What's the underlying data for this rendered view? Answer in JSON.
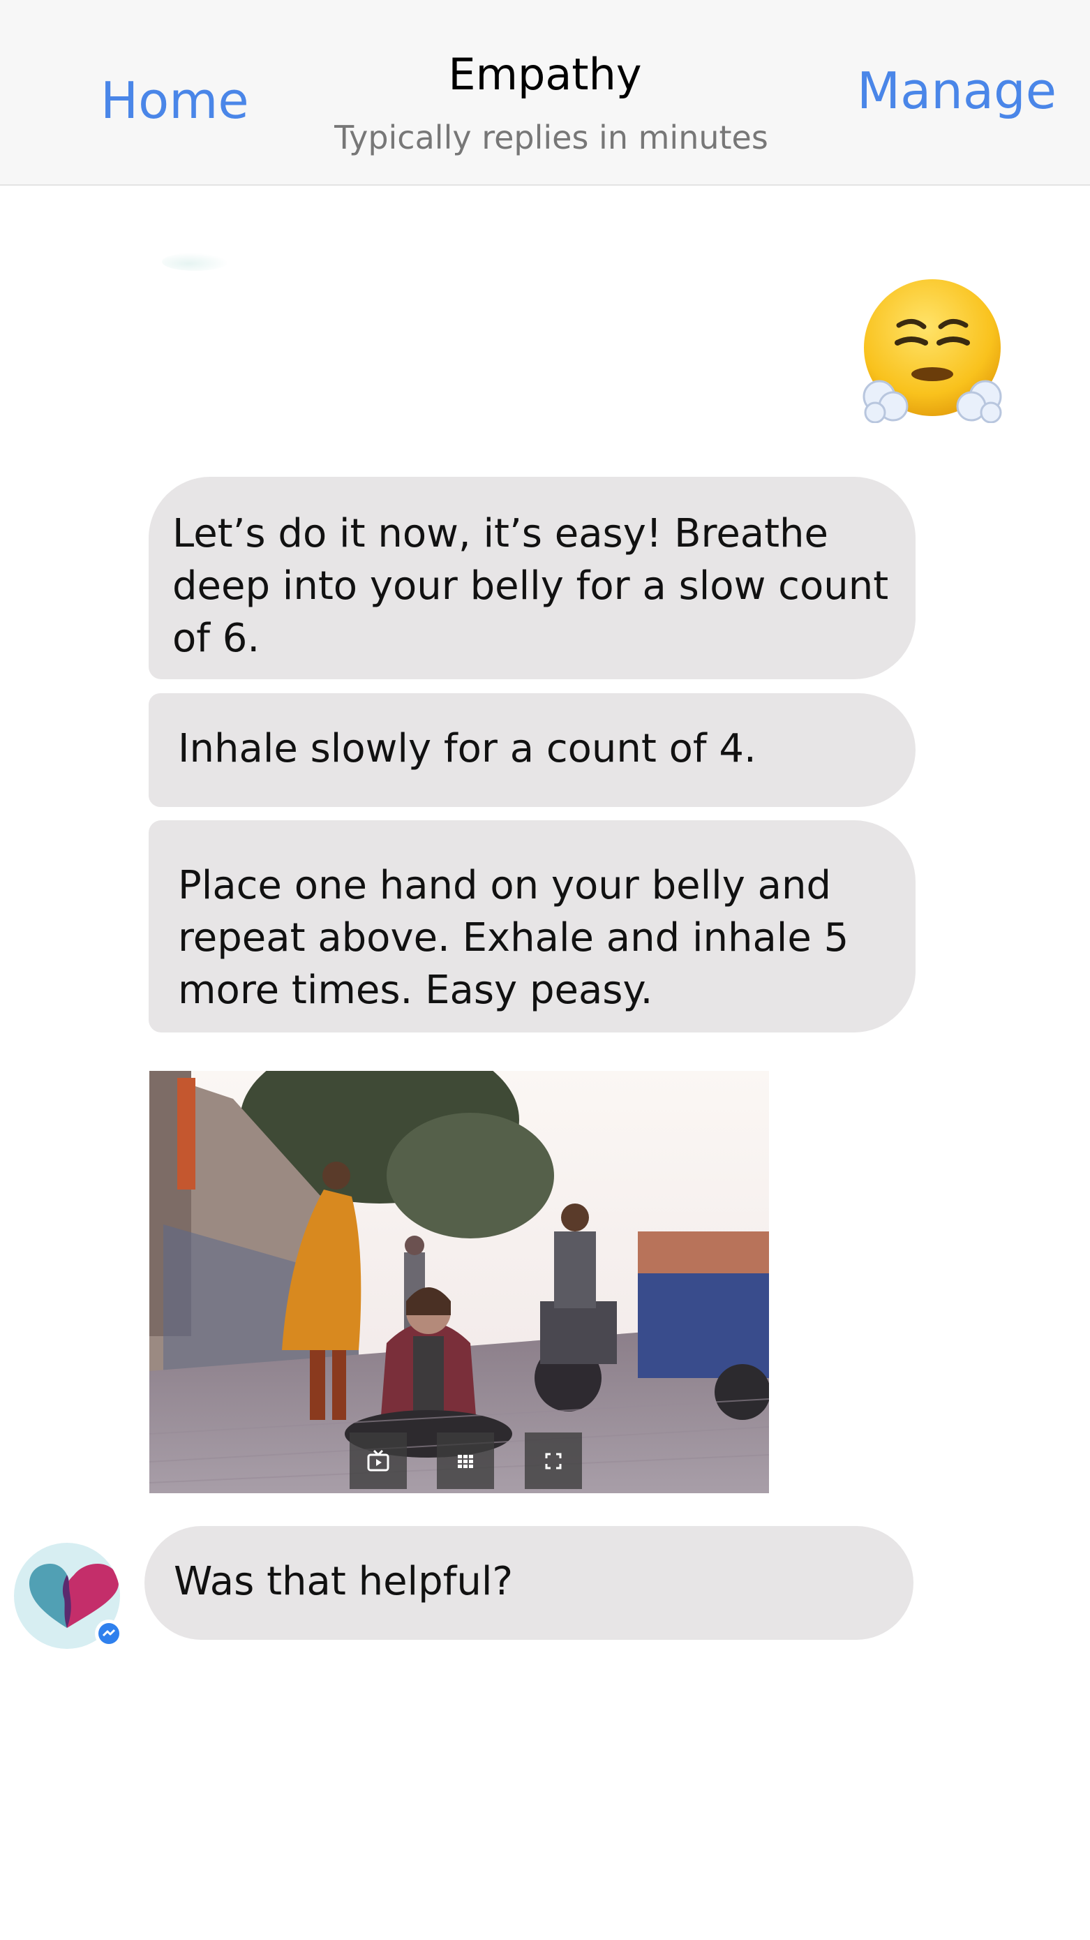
{
  "header": {
    "home_label": "Home",
    "title": "Empathy",
    "subtitle": "Typically replies in minutes",
    "manage_label": "Manage"
  },
  "messages": [
    {
      "text": "Let’s do it now, it’s easy! Breathe deep into your belly for a slow count of 6."
    },
    {
      "text": "Inhale slowly for a count of 4."
    },
    {
      "text": "Place one hand on your belly and repeat above. Exhale and inhale 5 more times. Easy peasy."
    },
    {
      "text": "Was that helpful?"
    }
  ],
  "media_controls": [
    "tv-icon",
    "grid-icon",
    "fullscreen-icon"
  ],
  "emoji": "steam-from-nose-emoji",
  "colors": {
    "accent": "#4a86e8",
    "bubble": "#e7e5e6",
    "header_bg": "#f7f7f7"
  }
}
